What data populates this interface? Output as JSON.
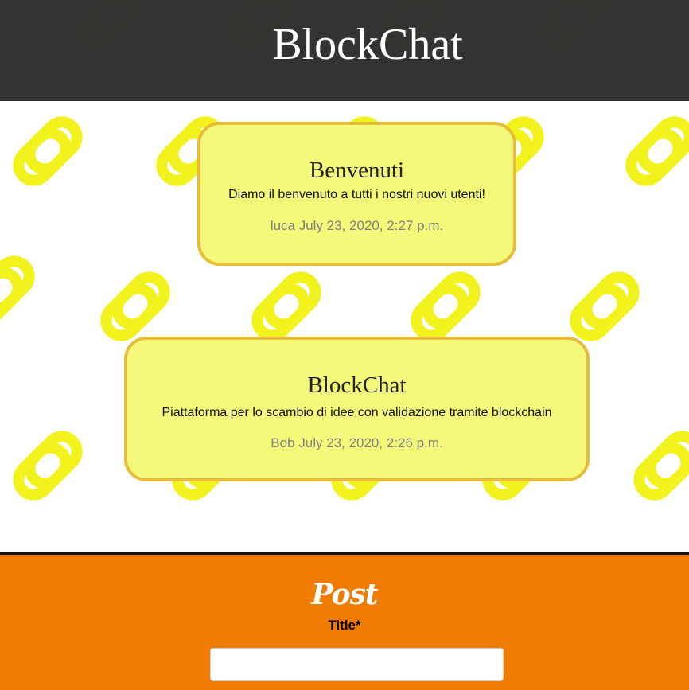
{
  "header": {
    "title": "BlockChat"
  },
  "posts": [
    {
      "title": "Benvenuti",
      "body": "Diamo il benvenuto a tutti i nostri nuovi utenti!",
      "meta": "luca July 23, 2020, 2:27 p.m."
    },
    {
      "title": "BlockChat",
      "body": "Piattaforma per lo scambio di idee con validazione tramite blockchain",
      "meta": "Bob July 23, 2020, 2:26 p.m."
    }
  ],
  "post_form": {
    "heading": "Post",
    "title_label": "Title*",
    "title_value": "",
    "title_placeholder": ""
  },
  "colors": {
    "header_bg": "#303030",
    "card_bg": "#f5f97a",
    "card_border": "#e6bd3a",
    "form_bg": "#ef7c00",
    "chain_icon": "#f2f21c"
  },
  "background_icon": "chain-link-icon"
}
